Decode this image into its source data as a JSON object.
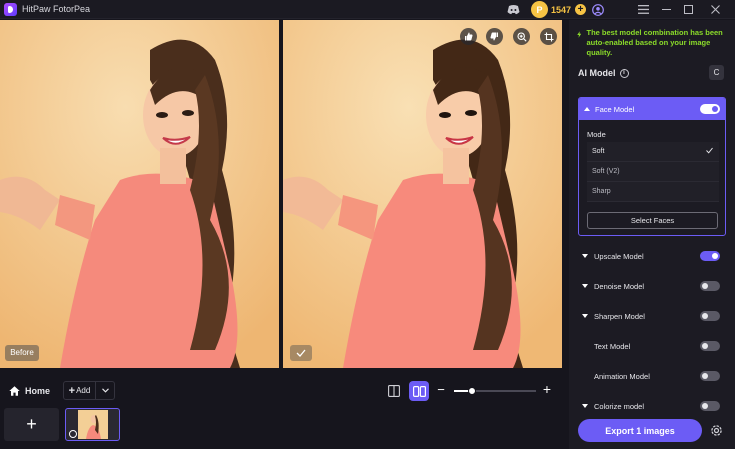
{
  "app": {
    "title": "HitPaw FotorPea"
  },
  "header": {
    "coins": "1547",
    "coin_symbol": "P"
  },
  "preview": {
    "before_label": "Before",
    "zoom_level": 0.22,
    "icons": [
      "thumbs-up-icon",
      "thumbs-down-icon",
      "zoom-in-icon",
      "crop-icon",
      "check-icon"
    ]
  },
  "bottom": {
    "home_label": "Home",
    "add_label": "Add",
    "add_tile_symbol": "+"
  },
  "panel": {
    "tip": "The best model combination has been auto-enabled based on your image quality.",
    "ai_model_title": "AI Model",
    "reset_symbol": "C",
    "face_model": {
      "label": "Face Model",
      "enabled": true,
      "mode_label": "Mode",
      "modes": [
        "Soft",
        "Soft (V2)",
        "Sharp"
      ],
      "selected": "Soft",
      "select_faces_label": "Select Faces"
    },
    "models": [
      {
        "label": "Upscale Model",
        "enabled": true,
        "expandable": true
      },
      {
        "label": "Denoise Model",
        "enabled": false,
        "expandable": true
      },
      {
        "label": "Sharpen Model",
        "enabled": false,
        "expandable": true
      },
      {
        "label": "Text Model",
        "enabled": false,
        "expandable": false
      },
      {
        "label": "Animation Model",
        "enabled": false,
        "expandable": false
      },
      {
        "label": "Colorize model",
        "enabled": false,
        "expandable": true
      }
    ],
    "export_label": "Export 1 images"
  },
  "colors": {
    "accent": "#6c5cf5",
    "tip_green": "#8bdc2a",
    "coin_gold": "#f6c344"
  }
}
